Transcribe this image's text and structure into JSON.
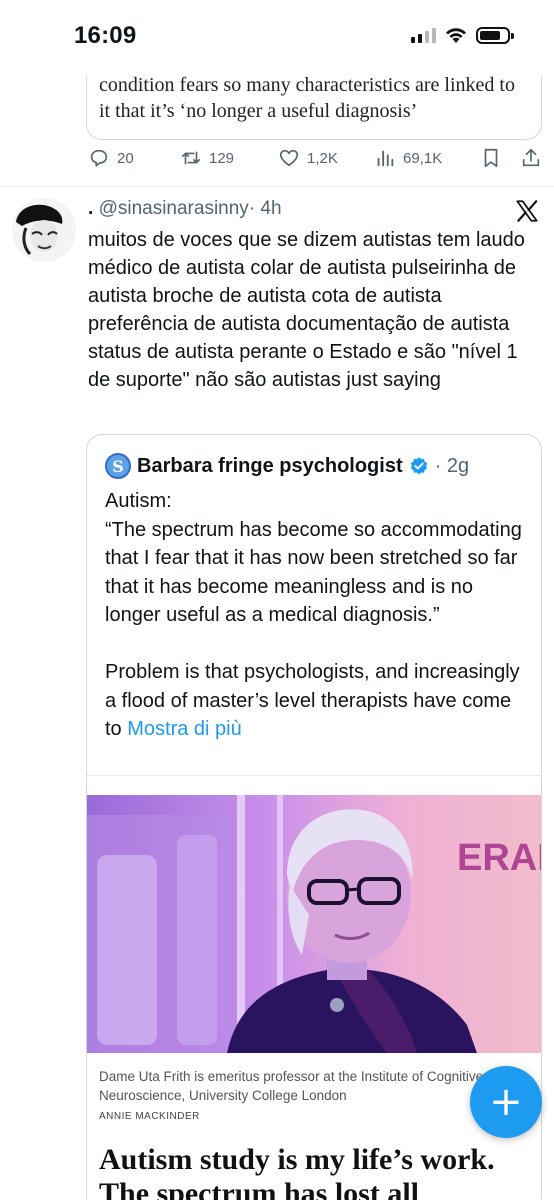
{
  "status_bar": {
    "time": "16:09",
    "icons": [
      "cellular-signal-icon",
      "wifi-icon",
      "battery-icon"
    ]
  },
  "previous_tweet": {
    "headline_lines": [
      "condition fears so many characteristics are linked to",
      "it that it’s ‘no longer a useful diagnosis’"
    ],
    "actions": {
      "replies": "20",
      "retweets": "129",
      "likes": "1,2K",
      "views": "69,1K"
    }
  },
  "tweet": {
    "display_name": ".",
    "handle": "@sinasinarasinny",
    "time": "· 4h",
    "source_icon": "x-logo-icon",
    "text": "muitos de voces que se dizem autistas tem laudo médico de autista colar de autista pulseirinha de autista broche de autista cota de autista preferência de autista documentação de autista status de autista perante o Estado e são \"nível 1 de suporte\" não são autistas just saying"
  },
  "quoted_tweet": {
    "avatar_letter": "S",
    "name": "Barbara fringe psychologist",
    "verified": true,
    "time": "· 2g",
    "text": "Autism:\n“The spectrum has become so accommodating that I fear that it has now been stretched so far that it has become meaningless and is no longer useful as a medical diagnosis.”\n\nProblem is that psychologists, and increasingly a flood of master’s level therapists have come to ",
    "show_more": "Mostra di più",
    "article": {
      "image_background_text": "ERAM",
      "caption": "Dame Uta Frith is emeritus professor at the Institute of Cognitive Neuroscience, University College London",
      "credit": "ANNIE MACKINDER",
      "title_lines": [
        "Autism study is my life’s work.",
        "The spectrum has lost all"
      ]
    }
  },
  "compose_button": {
    "label": "+"
  },
  "colors": {
    "accent": "#1d9bf0",
    "text": "#0f1419",
    "secondary": "#536471",
    "border": "#cfd9de"
  }
}
